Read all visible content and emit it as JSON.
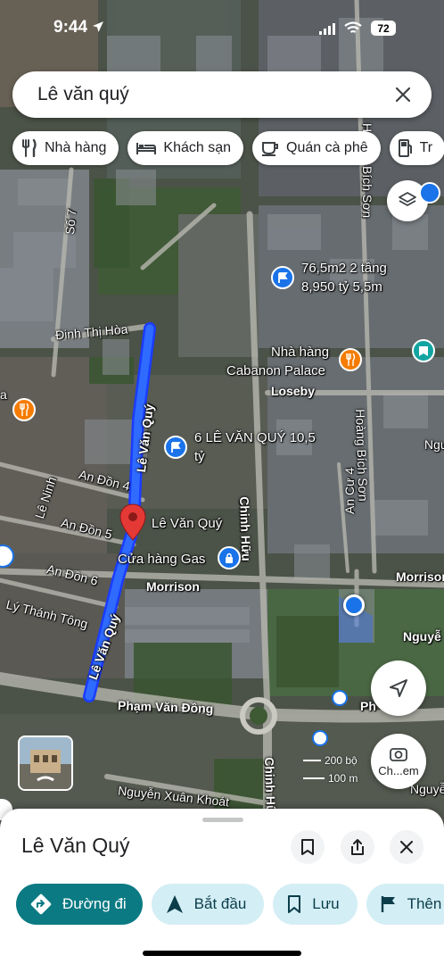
{
  "status": {
    "time": "9:44",
    "battery": "72"
  },
  "search": {
    "query": "Lê văn quý"
  },
  "chips": [
    {
      "label": "Nhà hàng",
      "icon": "fork-knife-icon"
    },
    {
      "label": "Khách sạn",
      "icon": "bed-icon"
    },
    {
      "label": "Quán cà phê",
      "icon": "coffee-icon"
    },
    {
      "label": "Tr",
      "icon": "gas-pump-icon"
    }
  ],
  "map": {
    "streets": {
      "so7": "Số 7",
      "dinh_thi_hoa": "Đinh Thị Hòa",
      "le_van_quy_upper": "Lê Văn Quý",
      "le_van_quy_lower": "Lê Văn Quý",
      "an_don_4": "An Đồn 4",
      "an_don_5": "An Đồn 5",
      "an_don_6": "An Đồn 6",
      "le_ninh": "Lê Ninh",
      "ly_thanh_tong": "Lý Thánh Tông",
      "morrison_center": "Morrison",
      "morrison_right": "Morrison",
      "chinh_huu": "Chinh Hữu",
      "chinh_huu_lower": "Chinh Hữu",
      "pham_van_dong": "Phạm Văn Đồng",
      "pham_right": "Ph",
      "nguyen_xuan_khoat": "Nguyễn Xuân Khoát",
      "loseby": "Loseby",
      "an_cu_4": "An Cư 4",
      "hoang_bich_son": "Hoàng Bích Sơn",
      "hoang_bich_son_top": "Bích Sơn",
      "h_top": "H",
      "nguye_right": "Nguyễ",
      "ngu_right": "Ngu",
      "nguyen_right_low": "Nguyễn",
      "a_left": "a"
    },
    "pois": {
      "listing1_line1": "76,5m2 2 tầng",
      "listing1_line2": "8,950 tỷ 5,5m",
      "restaurant_line1": "Nhà hàng",
      "restaurant_line2": "Cabanon Palace",
      "listing2_line1": "6 LÊ VĂN QUÝ 10,5",
      "listing2_line2": "tỷ",
      "selected_place": "Lê Văn Quý",
      "gas_store": "Cửa hàng Gas"
    },
    "scale": {
      "top": "200 bộ",
      "bottom": "100 m"
    },
    "explore_label": "Ch...em"
  },
  "sheet": {
    "title": "Lê Văn Quý",
    "actions": [
      {
        "label": "Đường đi",
        "icon": "directions-icon"
      },
      {
        "label": "Bắt đầu",
        "icon": "navigation-arrow-icon"
      },
      {
        "label": "Lưu",
        "icon": "bookmark-icon"
      },
      {
        "label": "Thên",
        "icon": "flag-icon"
      }
    ]
  },
  "colors": {
    "route": "#1a3cff",
    "accent_primary": "#0b7a83",
    "chip_action_bg": "#d3eef5",
    "pin_red": "#e53935",
    "location_blue": "#1a73e8"
  }
}
